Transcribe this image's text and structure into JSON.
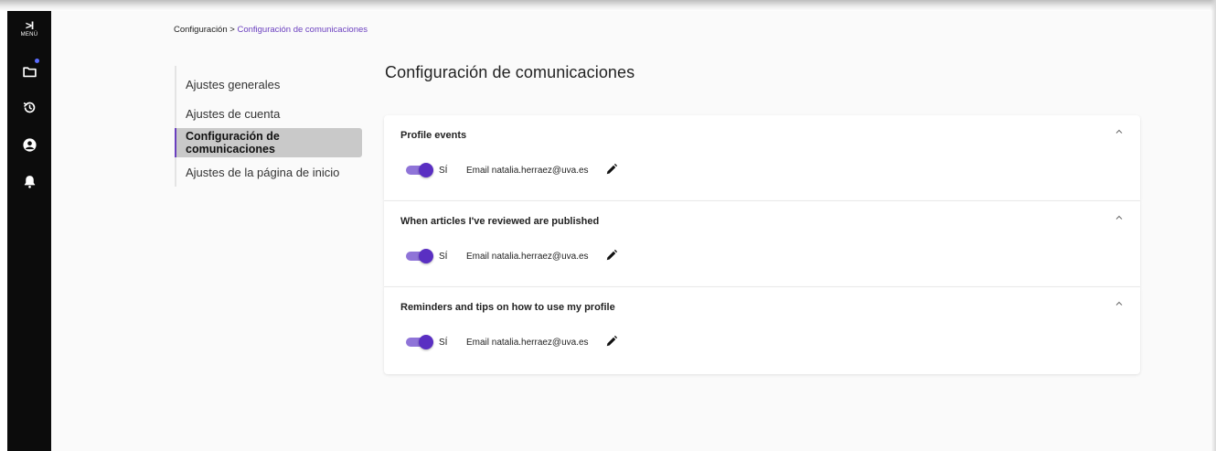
{
  "rail": {
    "menu_arrow": ">I",
    "menu_label": "MENÚ",
    "icons": [
      "folder-icon",
      "history-icon",
      "account-icon",
      "bell-icon"
    ],
    "accent_dot_color": "#5b6cff"
  },
  "breadcrumb": {
    "root": "Configuración",
    "separator": " > ",
    "current": "Configuración de comunicaciones"
  },
  "subnav": {
    "items": [
      {
        "label": "Ajustes generales",
        "active": false
      },
      {
        "label": "Ajustes de cuenta",
        "active": false
      },
      {
        "label": "Configuración de comunicaciones",
        "active": true
      },
      {
        "label": "Ajustes de la página de inicio",
        "active": false
      }
    ]
  },
  "page_title": "Configuración de comunicaciones",
  "panels": [
    {
      "title": "Profile events",
      "toggle_state": "on",
      "toggle_label": "SÍ",
      "email_text": "Email natalia.herraez@uva.es",
      "expanded": true
    },
    {
      "title": "When articles I've reviewed are published",
      "toggle_state": "on",
      "toggle_label": "SÍ",
      "email_text": "Email natalia.herraez@uva.es",
      "expanded": true
    },
    {
      "title": "Reminders and tips on how to use my profile",
      "toggle_state": "on",
      "toggle_label": "SÍ",
      "email_text": "Email natalia.herraez@uva.es",
      "expanded": true
    }
  ],
  "colors": {
    "accent": "#6a3fbf",
    "toggle_track": "#8f74d8",
    "toggle_knob": "#5a2fc2",
    "rail_bg": "#0c0c0c",
    "active_item_bg": "#c9c9c9"
  }
}
